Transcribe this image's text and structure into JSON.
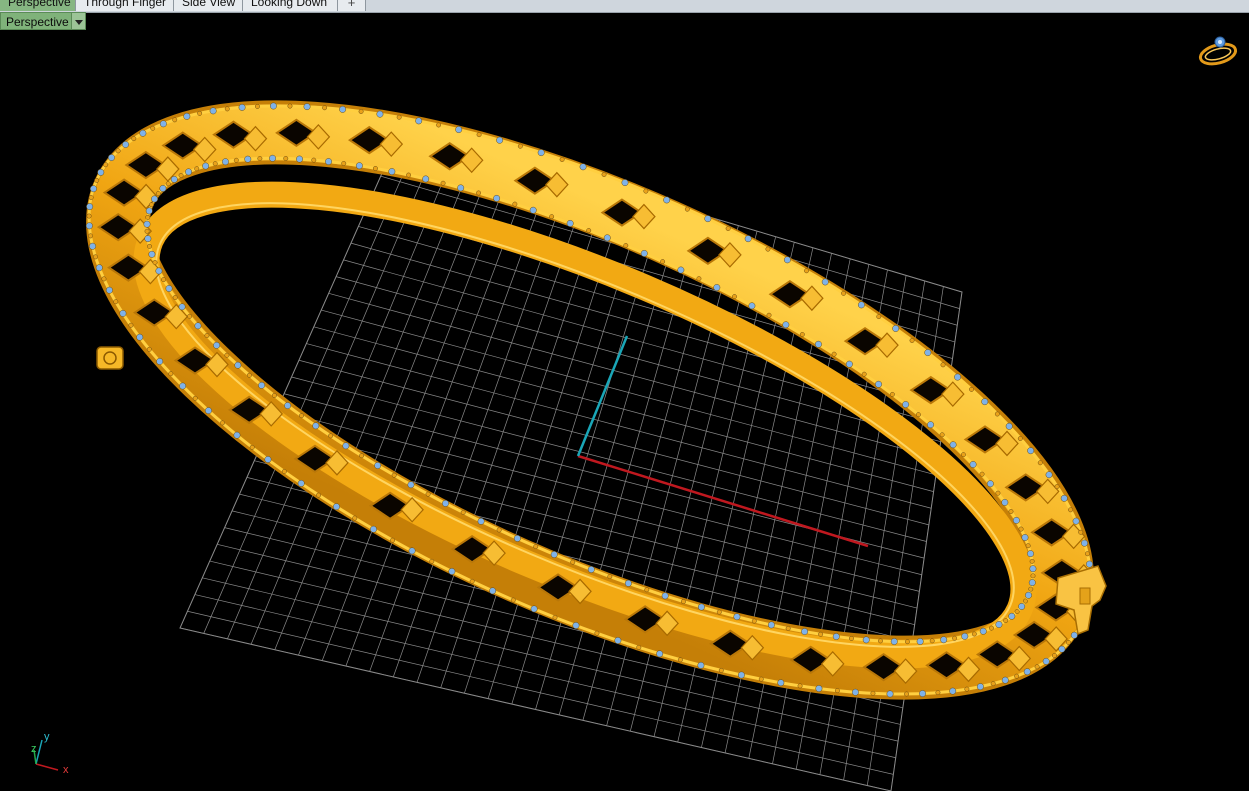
{
  "tabs": [
    {
      "label": "Perspective",
      "active": true
    },
    {
      "label": "Through Finger",
      "active": false
    },
    {
      "label": "Side View",
      "active": false
    },
    {
      "label": "Looking Down",
      "active": false
    }
  ],
  "add_tab_symbol": "+",
  "viewport": {
    "title": "Perspective",
    "colors": {
      "background": "#000000",
      "grid": "#8a8a8a",
      "x_axis": "#c0181f",
      "y_axis": "#1aa6b7",
      "gold": "#f3ad1b",
      "gold_dark": "#b97708",
      "gem": "#7fb2e8"
    }
  },
  "axis_widget": {
    "x": "x",
    "y": "y",
    "z": "z"
  },
  "icons": [
    "navigation-cube-icon",
    "dropdown-arrow-icon",
    "add-tab-icon"
  ]
}
